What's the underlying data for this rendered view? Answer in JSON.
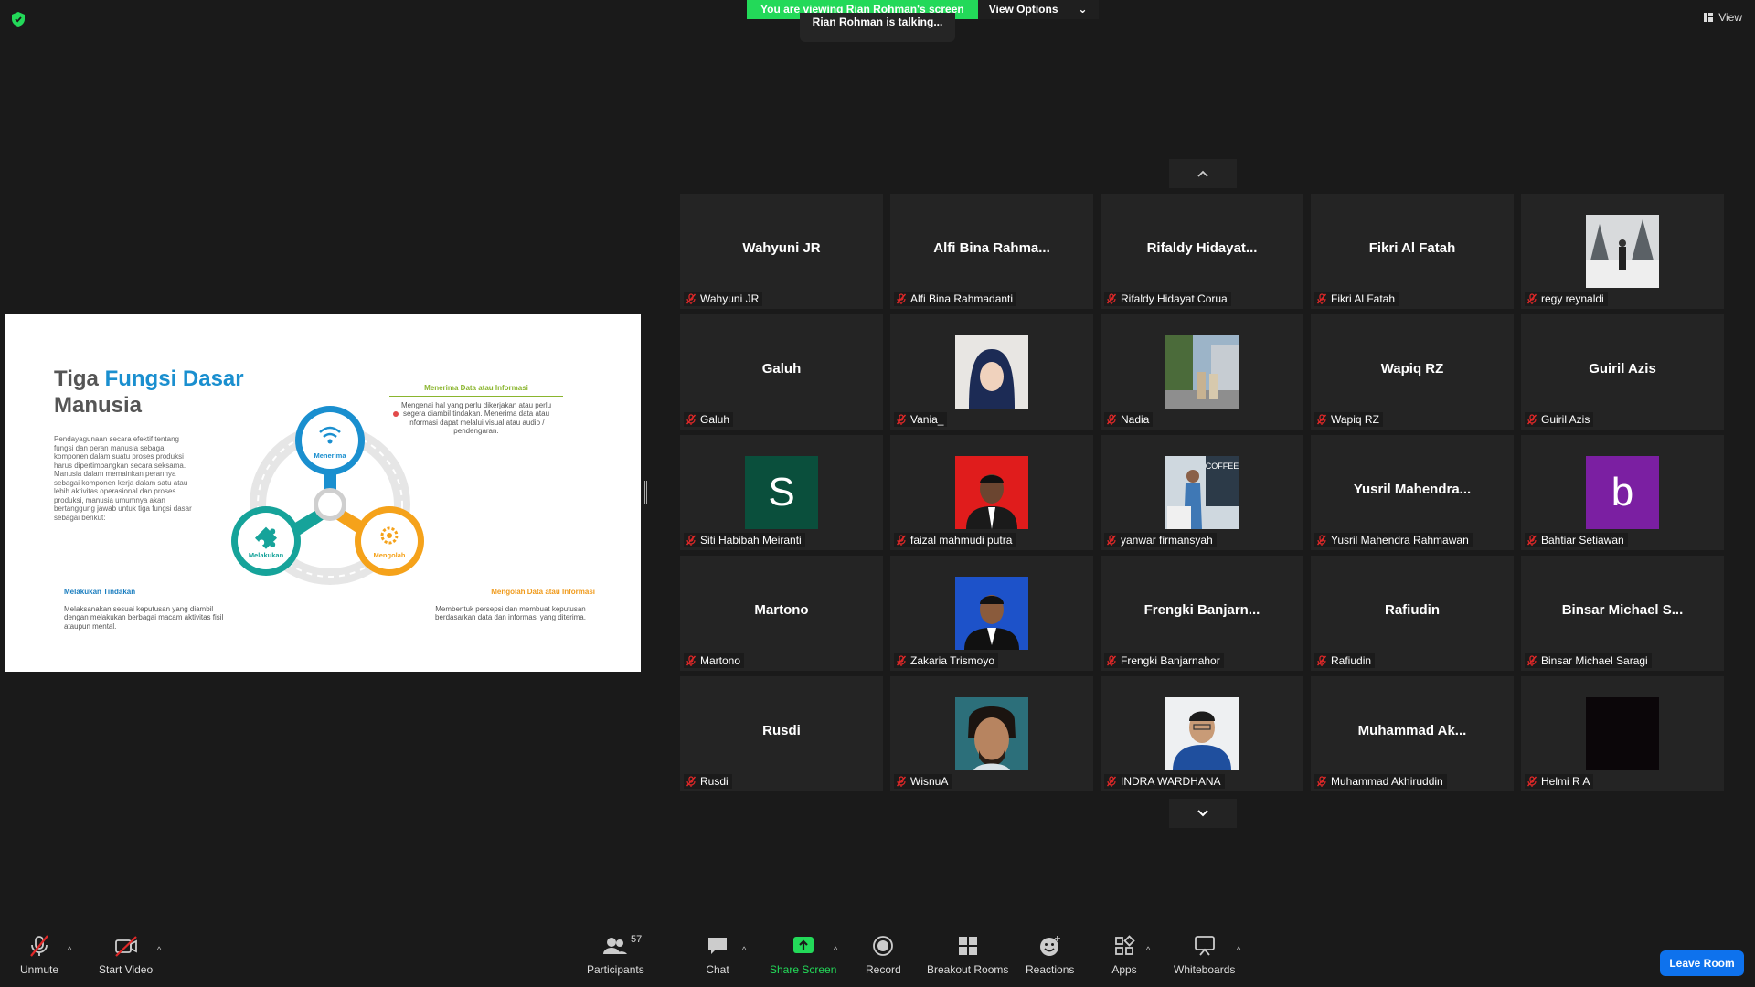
{
  "banner": {
    "viewing": "You are viewing Rian Rohman's screen",
    "view_options": "View Options",
    "talking": "Rian Rohman is talking..."
  },
  "top_right": {
    "view_label": "View"
  },
  "slide": {
    "title_plain": "Tiga ",
    "title_accent": "Fungsi Dasar",
    "title_line2": "Manusia",
    "description": "Pendayagunaan secara efektif tentang fungsi dan peran manusia sebagai komponen dalam suatu proses produksi harus dipertimbangkan secara seksama. Manusia dalam memainkan perannya sebagai komponen kerja dalam satu atau lebih aktivitas operasional dan proses produksi, manusia umumnya akan bertanggung jawab untuk tiga fungsi dasar sebagai berikut:",
    "node_receive": "Menerima",
    "node_do": "Melakukan",
    "node_process": "Mengolah",
    "callout_receive_title": "Menerima Data atau Informasi",
    "callout_receive_body": "Mengenai hal yang perlu dikerjakan atau perlu segera diambil tindakan. Menerima data atau informasi dapat melalui visual atau audio / pendengaran.",
    "callout_do_title": "Melakukan Tindakan",
    "callout_do_body": "Melaksanakan sesuai keputusan yang diambil dengan melakukan berbagai macam aktivitas fisil ataupun mental.",
    "callout_process_title": "Mengolah Data atau Informasi",
    "callout_process_body": "Membentuk persepsi dan membuat keputusan berdasarkan data dan informasi yang diterima."
  },
  "participants": [
    {
      "display": "Wahyuni JR",
      "label": "Wahyuni JR",
      "type": "name"
    },
    {
      "display": "Alfi Bina Rahma...",
      "label": "Alfi Bina Rahmadanti",
      "type": "name"
    },
    {
      "display": "Rifaldy  Hidayat...",
      "label": "Rifaldy Hidayat Corua",
      "type": "name"
    },
    {
      "display": "Fikri Al Fatah",
      "label": "Fikri Al Fatah",
      "type": "name"
    },
    {
      "display": "",
      "label": "regy reynaldi",
      "type": "photo",
      "photo": "snow"
    },
    {
      "display": "Galuh",
      "label": "Galuh",
      "type": "name"
    },
    {
      "display": "",
      "label": "Vania_",
      "type": "photo",
      "photo": "hijab"
    },
    {
      "display": "",
      "label": "Nadia",
      "type": "photo",
      "photo": "outdoor"
    },
    {
      "display": "Wapiq RZ",
      "label": "Wapiq RZ",
      "type": "name"
    },
    {
      "display": "Guiril Azis",
      "label": "Guiril Azis",
      "type": "name"
    },
    {
      "display": "S",
      "label": "Siti Habibah Meiranti",
      "type": "letter",
      "color": "#0a4f3c"
    },
    {
      "display": "",
      "label": "faizal mahmudi putra",
      "type": "photo",
      "photo": "redbg"
    },
    {
      "display": "",
      "label": "yanwar firmansyah",
      "type": "photo",
      "photo": "coffee"
    },
    {
      "display": "Yusril  Mahendra...",
      "label": "Yusril Mahendra Rahmawan",
      "type": "name"
    },
    {
      "display": "b",
      "label": "Bahtiar Setiawan",
      "type": "letter",
      "color": "#7b1fa2"
    },
    {
      "display": "Martono",
      "label": "Martono",
      "type": "name"
    },
    {
      "display": "",
      "label": "Zakaria Trismoyo",
      "type": "photo",
      "photo": "bluebg"
    },
    {
      "display": "Frengki  Banjarn...",
      "label": "Frengki Banjarnahor",
      "type": "name"
    },
    {
      "display": "Rafiudin",
      "label": "Rafiudin",
      "type": "name"
    },
    {
      "display": "Binsar  Michael  S...",
      "label": "Binsar Michael Saragi",
      "type": "name"
    },
    {
      "display": "Rusdi",
      "label": "Rusdi",
      "type": "name"
    },
    {
      "display": "",
      "label": "WisnuA",
      "type": "photo",
      "photo": "face"
    },
    {
      "display": "",
      "label": "INDRA WARDHANA",
      "type": "photo",
      "photo": "bluejacket"
    },
    {
      "display": "Muhammad  Ak...",
      "label": "Muhammad Akhiruddin",
      "type": "name"
    },
    {
      "display": "",
      "label": "Helmi R A",
      "type": "photo",
      "photo": "dark"
    }
  ],
  "toolbar": {
    "unmute": "Unmute",
    "start_video": "Start Video",
    "participants": "Participants",
    "participants_count": "57",
    "chat": "Chat",
    "share_screen": "Share Screen",
    "record": "Record",
    "breakout_rooms": "Breakout Rooms",
    "reactions": "Reactions",
    "apps": "Apps",
    "whiteboards": "Whiteboards",
    "leave_room": "Leave Room"
  },
  "colors": {
    "share_green": "#23d959",
    "leave_blue": "#0e72ed",
    "muted_red": "#e02828",
    "tile_bg": "#242424"
  }
}
